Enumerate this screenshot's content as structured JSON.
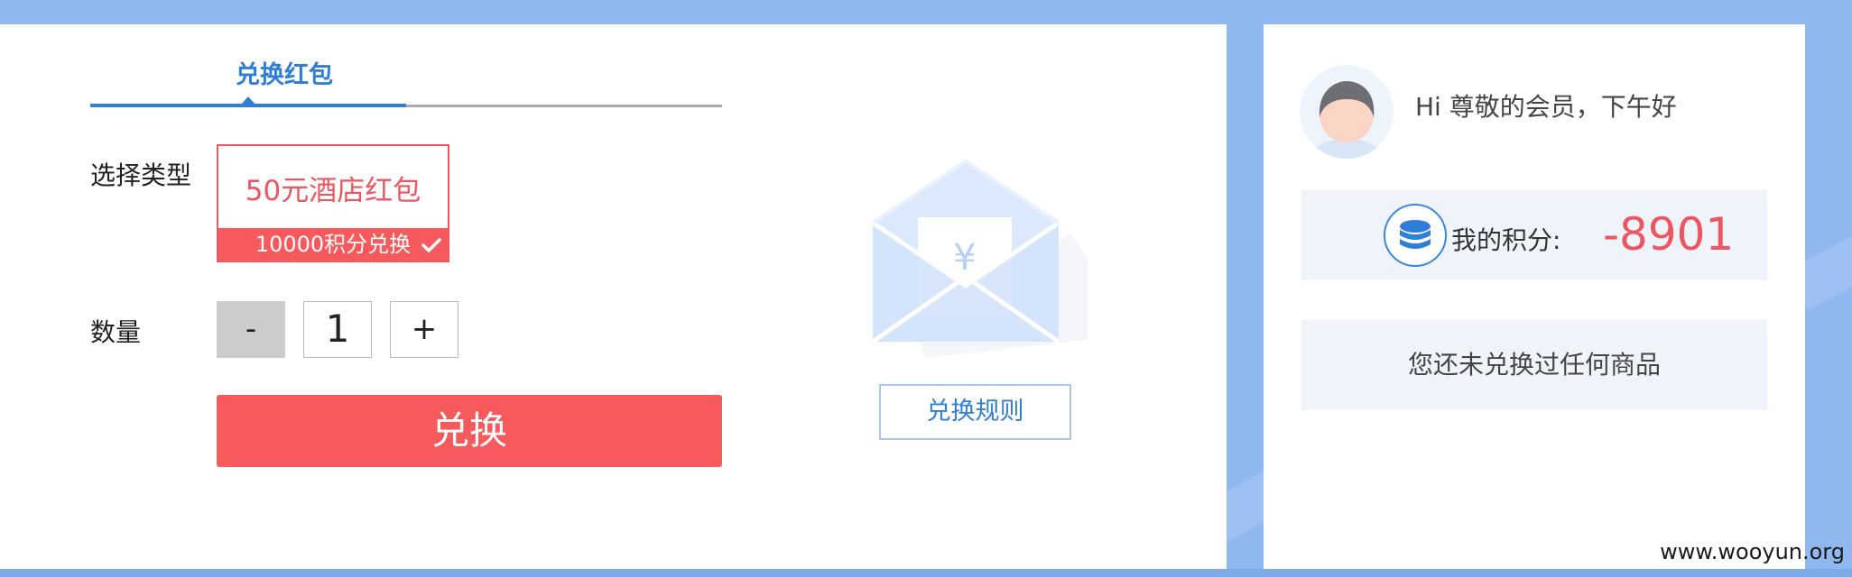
{
  "tab": {
    "label": "兑换红包"
  },
  "form": {
    "type_label": "选择类型",
    "type_card": {
      "title": "50元酒店红包",
      "cost": "10000积分兑换"
    },
    "quantity_label": "数量",
    "minus": "-",
    "quantity": "1",
    "plus": "+",
    "submit": "兑换"
  },
  "envelope": {
    "currency_symbol": "¥"
  },
  "rules_button": "兑换规则",
  "user": {
    "greeting": "Hi 尊敬的会员，下午好",
    "points_label": "我的积分:",
    "points_value": "-8901",
    "history_empty": "您还未兑换过任何商品"
  },
  "watermark": "www.wooyun.org",
  "colors": {
    "accent_blue": "#2f7fd8",
    "accent_red": "#f65a5c",
    "background": "#8fb7f0"
  }
}
